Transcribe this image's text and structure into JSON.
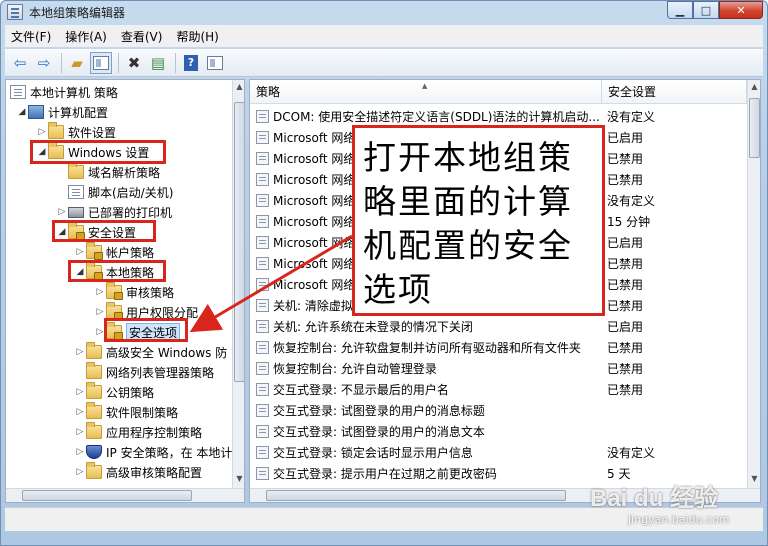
{
  "window": {
    "title": "本地组策略编辑器",
    "controls": {
      "minimize": "▁",
      "maximize": "□",
      "close": "✕"
    }
  },
  "menu": [
    "文件(F)",
    "操作(A)",
    "查看(V)",
    "帮助(H)"
  ],
  "toolbar": {
    "back_icon": "arrow-left-icon",
    "forward_icon": "arrow-right-icon",
    "up_icon": "folder-up-icon",
    "show_hide_icon": "panel-icon",
    "delete_icon": "delete-x-icon",
    "export_icon": "export-list-icon",
    "help_label": "?",
    "extra_icon": "console-tree-icon"
  },
  "tree": [
    {
      "label": "本地计算机 策略",
      "icon": "doc",
      "arrow": ""
    },
    {
      "label": "计算机配置",
      "icon": "pc",
      "arrow": "◢"
    },
    {
      "label": "软件设置",
      "icon": "folder",
      "arrow": "▷"
    },
    {
      "label": "Windows 设置",
      "icon": "folder",
      "arrow": "◢"
    },
    {
      "label": "域名解析策略",
      "icon": "folder",
      "arrow": ""
    },
    {
      "label": "脚本(启动/关机)",
      "icon": "doc",
      "arrow": ""
    },
    {
      "label": "已部署的打印机",
      "icon": "printer",
      "arrow": "▷"
    },
    {
      "label": "安全设置",
      "icon": "folder-lock",
      "arrow": "◢"
    },
    {
      "label": "帐户策略",
      "icon": "folder-lock",
      "arrow": "▷"
    },
    {
      "label": "本地策略",
      "icon": "folder-lock",
      "arrow": "◢"
    },
    {
      "label": "审核策略",
      "icon": "folder-lock",
      "arrow": "▷"
    },
    {
      "label": "用户权限分配",
      "icon": "folder-lock",
      "arrow": "▷"
    },
    {
      "label": "安全选项",
      "icon": "folder-lock",
      "arrow": "▷"
    },
    {
      "label": "高级安全 Windows 防",
      "icon": "folder",
      "arrow": "▷"
    },
    {
      "label": "网络列表管理器策略",
      "icon": "folder",
      "arrow": ""
    },
    {
      "label": "公钥策略",
      "icon": "folder",
      "arrow": "▷"
    },
    {
      "label": "软件限制策略",
      "icon": "folder",
      "arrow": "▷"
    },
    {
      "label": "应用程序控制策略",
      "icon": "folder",
      "arrow": "▷"
    },
    {
      "label": "IP 安全策略，在 本地计",
      "icon": "shield",
      "arrow": "▷"
    },
    {
      "label": "高级审核策略配置",
      "icon": "folder",
      "arrow": "▷"
    }
  ],
  "policy_table": {
    "columns": [
      "策略",
      "安全设置"
    ],
    "rows": [
      {
        "name": "DCOM: 使用安全描述符定义语言(SDDL)语法的计算机启动...",
        "value": "没有定义"
      },
      {
        "name": "Microsoft 网络",
        "value": "已启用"
      },
      {
        "name": "Microsoft 网络",
        "value": "已禁用"
      },
      {
        "name": "Microsoft 网络",
        "value": "已禁用"
      },
      {
        "name": "Microsoft 网络",
        "value": "没有定义"
      },
      {
        "name": "Microsoft 网络",
        "value": "15 分钟"
      },
      {
        "name": "Microsoft 网络",
        "value": "已启用"
      },
      {
        "name": "Microsoft 网络",
        "value": "已禁用"
      },
      {
        "name": "Microsoft 网络",
        "value": "已禁用"
      },
      {
        "name": "关机: 清除虚拟",
        "value": "已禁用"
      },
      {
        "name": "关机: 允许系统在未登录的情况下关闭",
        "value": "已启用"
      },
      {
        "name": "恢复控制台: 允许软盘复制并访问所有驱动器和所有文件夹",
        "value": "已禁用"
      },
      {
        "name": "恢复控制台: 允许自动管理登录",
        "value": "已禁用"
      },
      {
        "name": "交互式登录: 不显示最后的用户名",
        "value": "已禁用"
      },
      {
        "name": "交互式登录: 试图登录的用户的消息标题",
        "value": ""
      },
      {
        "name": "交互式登录: 试图登录的用户的消息文本",
        "value": ""
      },
      {
        "name": "交互式登录: 锁定会话时显示用户信息",
        "value": "没有定义"
      },
      {
        "name": "交互式登录: 提示用户在过期之前更改密码",
        "value": "5 天"
      }
    ]
  },
  "callout": {
    "text": "打开本地组策略里面的计算机配置的安全选项"
  },
  "annotation_color": "#d9261c",
  "watermark": {
    "logo": "Bai du 经验",
    "sub": "jingyan.baidu.com"
  }
}
